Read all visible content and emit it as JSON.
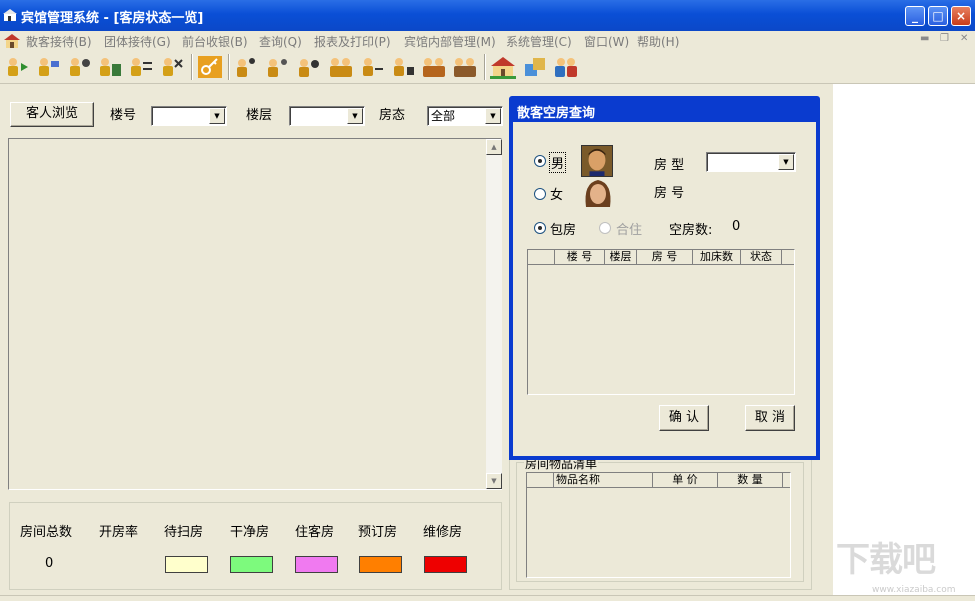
{
  "window": {
    "title": "宾馆管理系统 - [客房状态一览]"
  },
  "menu": {
    "items": [
      "散客接待(B)",
      "团体接待(G)",
      "前台收银(B)",
      "查询(Q)",
      "报表及打印(P)",
      "宾馆内部管理(M)",
      "系统管理(C)",
      "窗口(W)",
      "帮助(H)"
    ]
  },
  "toolbar": {
    "icons": [
      "guest-checkin-icon",
      "guest-change-icon",
      "guest-extend-icon",
      "guest-checkout-icon",
      "guest-transfer-icon",
      "guest-cancel-icon",
      "key-icon",
      "group-checkin-icon",
      "group-change-icon",
      "group-extend-icon",
      "group-checkout-icon",
      "group-transfer-icon",
      "group-cancel-icon",
      "group-query-icon",
      "group-bill-icon",
      "hotel-icon",
      "rooms-icon",
      "staff-icon"
    ]
  },
  "filters": {
    "guest_browse_label": "客人浏览",
    "building_label": "楼号",
    "building_value": "",
    "floor_label": "楼层",
    "floor_value": "",
    "status_label": "房态",
    "status_value": "全部"
  },
  "stats": {
    "total_rooms_label": "房间总数",
    "total_rooms_value": "0",
    "open_rate_label": "开房率",
    "legend": [
      {
        "label": "待扫房",
        "color": "#ffffcc"
      },
      {
        "label": "干净房",
        "color": "#7dfa7d"
      },
      {
        "label": "住客房",
        "color": "#f07af0"
      },
      {
        "label": "预订房",
        "color": "#ff7f00"
      },
      {
        "label": "维修房",
        "color": "#ee0000"
      }
    ]
  },
  "items_list": {
    "title": "房间物品清单",
    "columns": [
      "物品名称",
      "单  价",
      "数  量"
    ]
  },
  "dialog": {
    "title": "散客空房查询",
    "male_label": "男",
    "female_label": "女",
    "room_type_label": "房 型",
    "room_type_value": "",
    "room_number_label": "房 号",
    "package_label": "包房",
    "shared_label": "合住",
    "vacant_count_label": "空房数:",
    "vacant_count_value": "0",
    "columns": [
      "楼 号",
      "楼层",
      "房 号",
      "加床数",
      "状态"
    ],
    "ok_label": "确 认",
    "cancel_label": "取 消"
  },
  "watermark": {
    "text": "下载吧",
    "url_text": "www.xiazaiba.com"
  }
}
